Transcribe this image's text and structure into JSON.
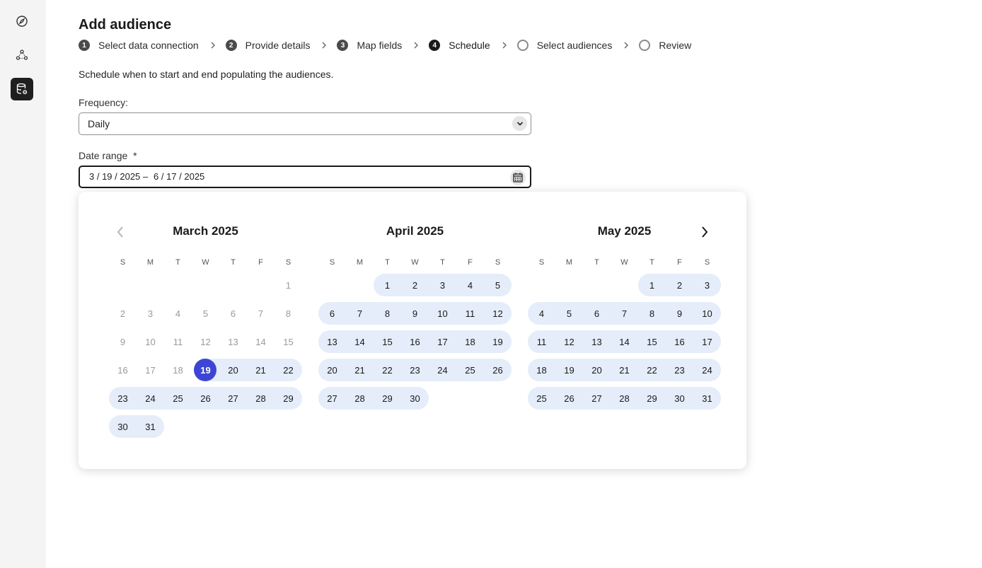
{
  "rail": {
    "items": [
      {
        "icon": "compass-icon",
        "active": false
      },
      {
        "icon": "audience-network-icon",
        "active": false
      },
      {
        "icon": "data-settings-icon",
        "active": true
      }
    ]
  },
  "page": {
    "title": "Add audience",
    "description": "Schedule when to start and end populating the audiences."
  },
  "steps": [
    {
      "number": "1",
      "label": "Select data connection",
      "state": "done"
    },
    {
      "number": "2",
      "label": "Provide details",
      "state": "done"
    },
    {
      "number": "3",
      "label": "Map fields",
      "state": "done"
    },
    {
      "number": "4",
      "label": "Schedule",
      "state": "current"
    },
    {
      "number": "",
      "label": "Select audiences",
      "state": "pending"
    },
    {
      "number": "",
      "label": "Review",
      "state": "pending"
    }
  ],
  "frequency": {
    "label": "Frequency:",
    "value": "Daily"
  },
  "date_range": {
    "label": "Date range",
    "required_mark": "*",
    "start": "3 / 19 / 2025",
    "separator": "–",
    "end": "6 / 17 / 2025"
  },
  "calendar": {
    "weekdays": [
      "S",
      "M",
      "T",
      "W",
      "T",
      "F",
      "S"
    ],
    "months": [
      {
        "title": "March 2025",
        "first_weekday": 6,
        "days": 31
      },
      {
        "title": "April 2025",
        "first_weekday": 2,
        "days": 30
      },
      {
        "title": "May 2025",
        "first_weekday": 4,
        "days": 31
      }
    ],
    "selected_start": {
      "month": 0,
      "day": 19
    },
    "colors": {
      "accent": "#3d46d4",
      "range": "#e4edf9"
    }
  }
}
